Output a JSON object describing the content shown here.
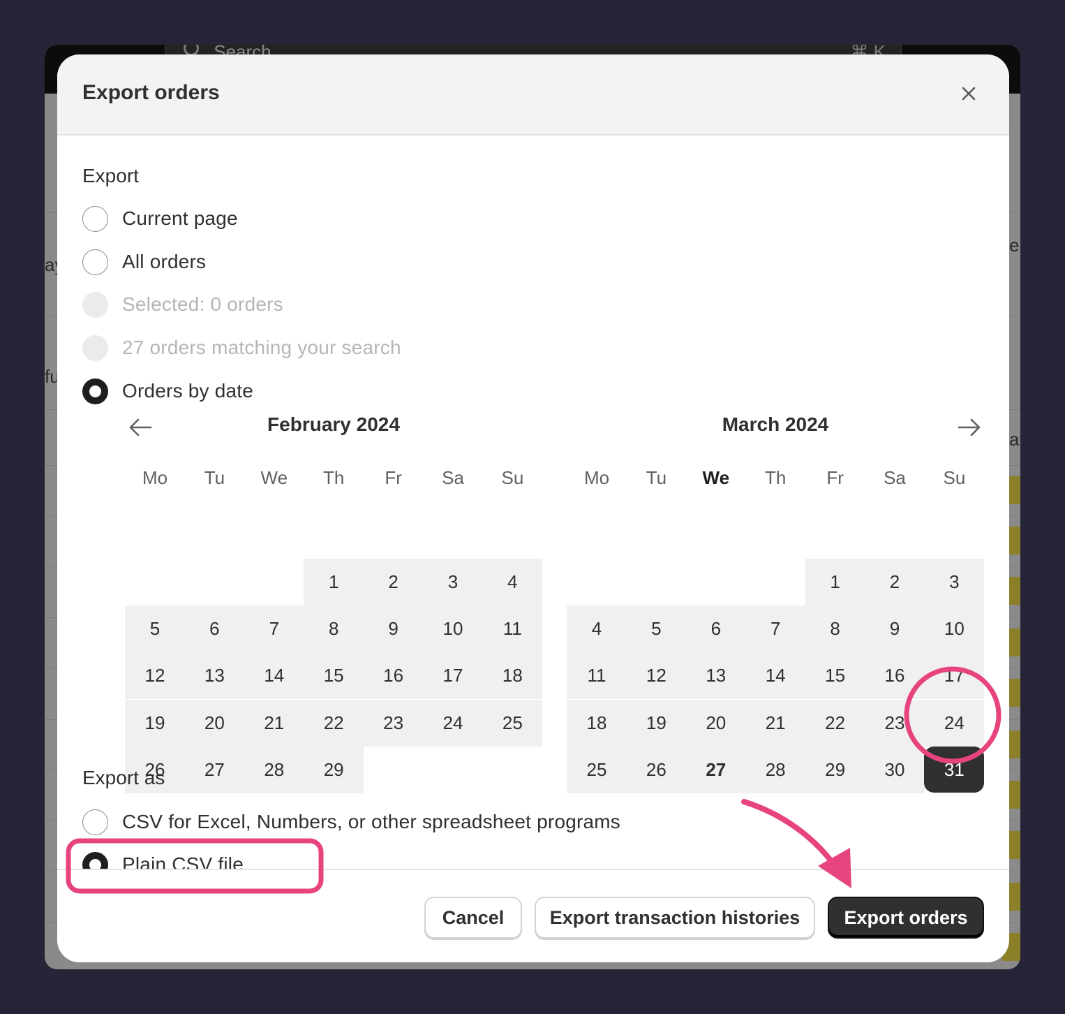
{
  "background": {
    "search_placeholder": "Search",
    "search_shortcut": "⌘ K",
    "fragments": [
      "ay",
      "fu",
      "e",
      "at"
    ]
  },
  "modal": {
    "title": "Export orders",
    "close_icon": "close-icon"
  },
  "export_section": {
    "label": "Export",
    "options": [
      {
        "label": "Current page",
        "state": "unchecked"
      },
      {
        "label": "All orders",
        "state": "unchecked"
      },
      {
        "label": "Selected: 0 orders",
        "state": "disabled"
      },
      {
        "label": "27 orders matching your search",
        "state": "disabled"
      },
      {
        "label": "Orders by date",
        "state": "checked"
      }
    ]
  },
  "calendar": {
    "prev_icon": "arrow-left-icon",
    "next_icon": "arrow-right-icon",
    "weekdays": [
      "Mo",
      "Tu",
      "We",
      "Th",
      "Fr",
      "Sa",
      "Su"
    ],
    "months": [
      {
        "title": "February 2024",
        "first_weekday_index": 3,
        "days": 29,
        "today": null,
        "selected": null
      },
      {
        "title": "March 2024",
        "first_weekday_index": 4,
        "days": 31,
        "today": 27,
        "today_weekday": "We",
        "selected": 31
      }
    ]
  },
  "export_as_section": {
    "label": "Export as",
    "options": [
      {
        "label": "CSV for Excel, Numbers, or other spreadsheet programs",
        "state": "unchecked"
      },
      {
        "label": "Plain CSV file",
        "state": "checked"
      }
    ]
  },
  "footer": {
    "cancel_label": "Cancel",
    "export_histories_label": "Export transaction histories",
    "export_orders_label": "Export orders"
  },
  "annotations": {
    "color": "#e7447f"
  }
}
